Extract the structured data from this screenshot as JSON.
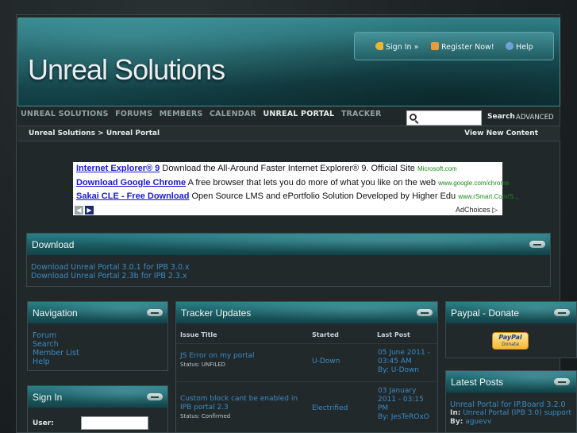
{
  "header": {
    "logo_text": "Unreal Solutions",
    "userbar": {
      "sign_in": "Sign In »",
      "register": "Register Now!",
      "help": "Help"
    }
  },
  "nav": {
    "items": [
      {
        "label": "UNREAL SOLUTIONS",
        "active": false
      },
      {
        "label": "FORUMS",
        "active": false
      },
      {
        "label": "MEMBERS",
        "active": false
      },
      {
        "label": "CALENDAR",
        "active": false
      },
      {
        "label": "UNREAL PORTAL",
        "active": true
      },
      {
        "label": "TRACKER",
        "active": false
      }
    ]
  },
  "search": {
    "placeholder": "",
    "button": "Search",
    "advanced": "ADVANCED"
  },
  "breadcrumb": {
    "path": "Unreal Solutions  > Unreal Portal",
    "view_new": "View New Content"
  },
  "ad": {
    "rows": [
      {
        "title": "Internet Explorer® 9",
        "text": " Download the All-Around Faster Internet Explorer® 9. Official Site ",
        "url": "Microsoft.com"
      },
      {
        "title": "Download Google Chrome",
        "text": " A free browser that lets you do more of what you like on the web ",
        "url": "www.google.com/chrome"
      },
      {
        "title": "Sakai CLE - Free Download",
        "text": " Open Source LMS and ePortfolio Solution Developed by Higher Edu ",
        "url": "www.rSmart.Com/S..."
      }
    ],
    "choices": "AdChoices"
  },
  "download": {
    "title": "Download",
    "links": [
      "Download Unreal Portal 3.0.1 for IPB 3.0.x",
      "Download Unreal Portal 2.3b for IPB 2.3.x"
    ]
  },
  "navigation": {
    "title": "Navigation",
    "links": [
      "Forum",
      "Search",
      "Member List",
      "Help"
    ]
  },
  "signin": {
    "title": "Sign In",
    "user_label": "User:"
  },
  "tracker": {
    "title": "Tracker Updates",
    "headers": [
      "Issue Title",
      "Started",
      "Last Post"
    ],
    "rows": [
      {
        "title": "JS Error on my portal",
        "status": "Status: UNFILED",
        "started": "U-Down",
        "last_date": "05 June 2011 - 03:45 AM",
        "last_by": "By: U-Down"
      },
      {
        "title": "Custom block cant be enabled in IPB portal 2.3",
        "status": "Status: Confirmed",
        "started": "Electrified",
        "last_date": "03 January 2011 - 03:15 PM",
        "last_by": "By: JesTeROxO"
      }
    ]
  },
  "paypal": {
    "title": "Paypal - Donate",
    "button_top": "PayPal",
    "button_bottom": "Donate"
  },
  "latest": {
    "title": "Latest Posts",
    "post_title": "Unreal Portal for IP.Board 3.2.0",
    "in_label": "In:",
    "in_value": " Unreal Portal (IPB 3.0) support",
    "by_label": "By:",
    "by_value": " aguevv"
  },
  "colors": {
    "accent": "#1c6a71",
    "link": "#3a8bc4"
  }
}
